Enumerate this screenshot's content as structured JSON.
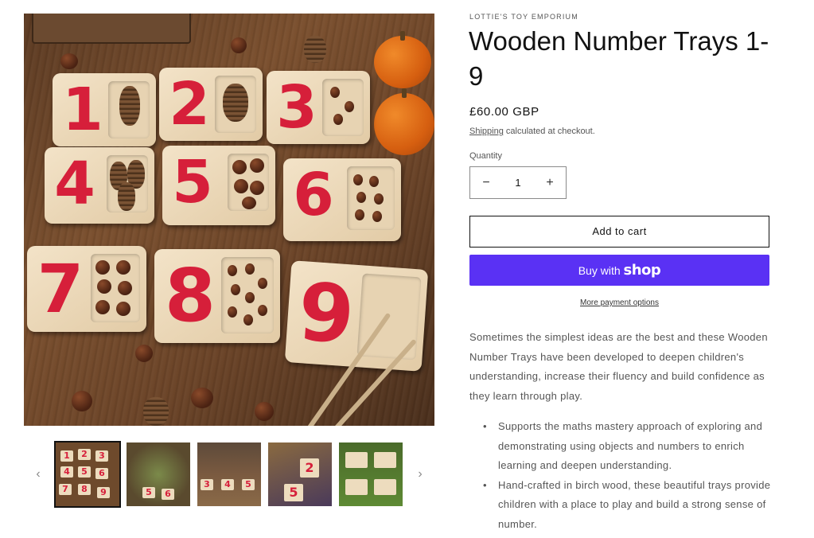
{
  "product": {
    "vendor": "LOTTIE'S TOY EMPORIUM",
    "title": "Wooden Number Trays 1-9",
    "price": "£60.00 GBP",
    "shipping_link": "Shipping",
    "shipping_rest": " calculated at checkout.",
    "quantity_label": "Quantity",
    "quantity_value": "1",
    "qty_minus": "−",
    "qty_plus": "+",
    "add_to_cart": "Add to cart",
    "buy_with": "Buy with ",
    "shop_brand": "shop",
    "more_payment": "More payment options",
    "description": "Sometimes the simplest ideas are the best and these Wooden Number Trays have been developed to deepen children's understanding, increase their fluency and build confidence as they learn through play.",
    "bullets": [
      "Supports the maths mastery approach of exploring and demonstrating using objects and numbers to enrich learning and deepen understanding.",
      "Hand-crafted in birch wood, these beautiful trays provide children with a place to play and build a strong sense of number."
    ]
  },
  "gallery": {
    "main_numbers": [
      "1",
      "2",
      "3",
      "4",
      "5",
      "6",
      "7",
      "8",
      "9"
    ],
    "prev_arrow": "‹",
    "next_arrow": "›",
    "thumbnail_count": 5,
    "active_thumbnail": 1
  },
  "colors": {
    "buy_button": "#5a31f4",
    "numeral_red": "#d61f3a"
  }
}
